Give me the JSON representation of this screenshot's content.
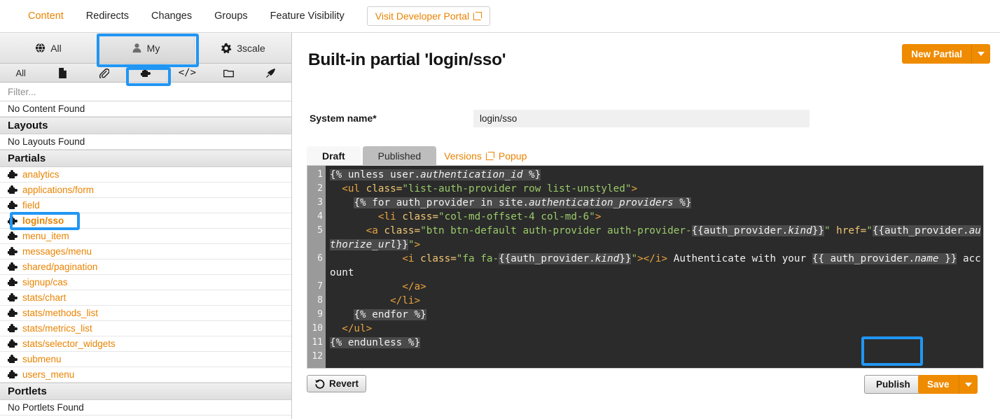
{
  "topnav": {
    "items": [
      {
        "label": "Content",
        "active": true
      },
      {
        "label": "Redirects",
        "active": false
      },
      {
        "label": "Changes",
        "active": false
      },
      {
        "label": "Groups",
        "active": false
      },
      {
        "label": "Feature Visibility",
        "active": false
      }
    ],
    "visit_portal": "Visit Developer Portal"
  },
  "sidebar": {
    "scope_tabs": [
      {
        "label": "All",
        "icon": "globe-icon",
        "active": false
      },
      {
        "label": "My",
        "icon": "user-icon",
        "active": true
      },
      {
        "label": "3scale",
        "icon": "gear-icon",
        "active": false
      }
    ],
    "type_tabs": [
      {
        "label": "All",
        "icon": "text-all",
        "active": false
      },
      {
        "label": "",
        "icon": "page-icon",
        "active": false
      },
      {
        "label": "",
        "icon": "paperclip-icon",
        "active": false
      },
      {
        "label": "",
        "icon": "puzzle-piece-icon",
        "active": true
      },
      {
        "label": "",
        "icon": "code-icon",
        "active": false
      },
      {
        "label": "",
        "icon": "folder-icon",
        "active": false
      },
      {
        "label": "",
        "icon": "rocket-icon",
        "active": false
      }
    ],
    "filter_placeholder": "Filter...",
    "filter_value": "",
    "groups": [
      {
        "name": "",
        "empty_text": "No Content Found",
        "items": []
      },
      {
        "name": "Layouts",
        "empty_text": "No Layouts Found",
        "items": []
      },
      {
        "name": "Partials",
        "empty_text": "",
        "items": [
          {
            "label": "analytics",
            "selected": false
          },
          {
            "label": "applications/form",
            "selected": false
          },
          {
            "label": "field",
            "selected": false
          },
          {
            "label": "login/sso",
            "selected": true
          },
          {
            "label": "menu_item",
            "selected": false
          },
          {
            "label": "messages/menu",
            "selected": false
          },
          {
            "label": "shared/pagination",
            "selected": false
          },
          {
            "label": "signup/cas",
            "selected": false
          },
          {
            "label": "stats/chart",
            "selected": false
          },
          {
            "label": "stats/methods_list",
            "selected": false
          },
          {
            "label": "stats/metrics_list",
            "selected": false
          },
          {
            "label": "stats/selector_widgets",
            "selected": false
          },
          {
            "label": "submenu",
            "selected": false
          },
          {
            "label": "users_menu",
            "selected": false
          }
        ]
      },
      {
        "name": "Portlets",
        "empty_text": "No Portlets Found",
        "items": []
      }
    ]
  },
  "main": {
    "title": "Built-in partial 'login/sso'",
    "new_partial_label": "New Partial",
    "system_name_label": "System name",
    "system_name_required_mark": "*",
    "system_name_value": "login/sso",
    "tabs": [
      {
        "label": "Draft",
        "active": true
      },
      {
        "label": "Published",
        "active": false
      }
    ],
    "versions_link": "Versions",
    "popup_link": "Popup",
    "revert_label": "Revert",
    "publish_label": "Publish",
    "save_label": "Save"
  },
  "editor": {
    "line_numbers": [
      "1",
      "2",
      "3",
      "4",
      "5",
      "6",
      "7",
      "8",
      "9",
      "10",
      "11",
      "12"
    ],
    "lines": [
      "{% unless user.authentication_id %}",
      "  <ul class=\"list-auth-provider row list-unstyled\">",
      "    {% for auth_provider in site.authentication_providers %}",
      "        <li class=\"col-md-offset-4 col-md-6\">",
      "      <a class=\"btn btn-default auth-provider auth-provider-{{auth_provider.kind}}\" href=\"{{auth_provider.authorize_url}}\">",
      "            <i class=\"fa fa-{{auth_provider.kind}}\"></i> Authenticate with your {{ auth_provider.name }} account",
      "            </a>",
      "          </li>",
      "    {% endfor %}",
      "  </ul>",
      "{% endunless %}",
      ""
    ]
  },
  "colors": {
    "accent_orange": "#e98300",
    "button_orange": "#ef8b00",
    "highlight_blue": "#2196f3",
    "editor_bg": "#2b2b2b",
    "gutter_bg": "#9a9a9a"
  },
  "highlights": [
    {
      "name": "my-tab-highlight"
    },
    {
      "name": "partials-type-tab-highlight"
    },
    {
      "name": "login-sso-item-highlight"
    },
    {
      "name": "publish-button-highlight"
    }
  ]
}
